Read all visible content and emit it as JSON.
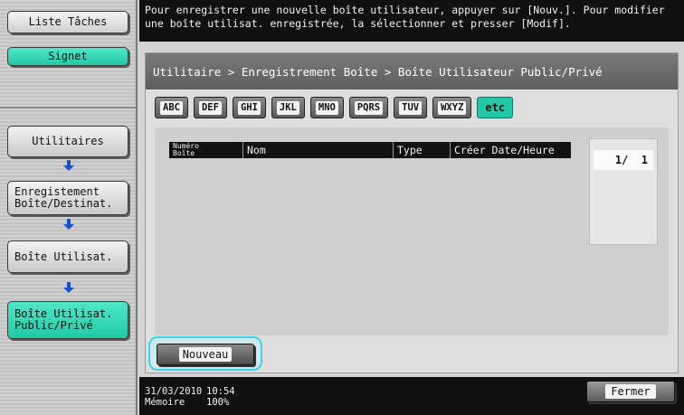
{
  "sidebar": {
    "job_list_label": "Liste Tâches",
    "bookmark_label": "Signet",
    "steps": [
      {
        "label": "Utilitaires"
      },
      {
        "label": "Enregistement\nBoîte/Destinat."
      },
      {
        "label": "Boîte Utilisat."
      },
      {
        "label": "Boîte Utilisat.\nPublic/Privé"
      }
    ]
  },
  "message": "Pour enregistrer une nouvelle boîte utilisateur, appuyer sur [Nouv.]. Pour modifier une boîte utilisat. enregistrée, la sélectionner et presser [Modif].",
  "breadcrumb": "Utilitaire > Enregistrement Boîte > Boîte Utilisateur Public/Privé",
  "index_tabs": [
    {
      "label": "ABC",
      "selected": false
    },
    {
      "label": "DEF",
      "selected": false
    },
    {
      "label": "GHI",
      "selected": false
    },
    {
      "label": "JKL",
      "selected": false
    },
    {
      "label": "MNO",
      "selected": false
    },
    {
      "label": "PQRS",
      "selected": false
    },
    {
      "label": "TUV",
      "selected": false
    },
    {
      "label": "WXYZ",
      "selected": false
    },
    {
      "label": "etc",
      "selected": true
    }
  ],
  "table": {
    "columns": {
      "number": "Numéro\nBoîte",
      "name": "Nom",
      "type": "Type",
      "created": "Créer Date/Heure"
    },
    "rows": []
  },
  "pagination": "1/  1",
  "new_button": "Nouveau",
  "status": {
    "date": "31/03/2010",
    "time": "10:54",
    "memory_label": "Mémoire",
    "memory_value": "100%"
  },
  "close_button": "Fermer",
  "colors": {
    "accent_teal": "#22c9a6",
    "highlight_cyan": "#3ad6e6",
    "bar_black": "#111111"
  }
}
